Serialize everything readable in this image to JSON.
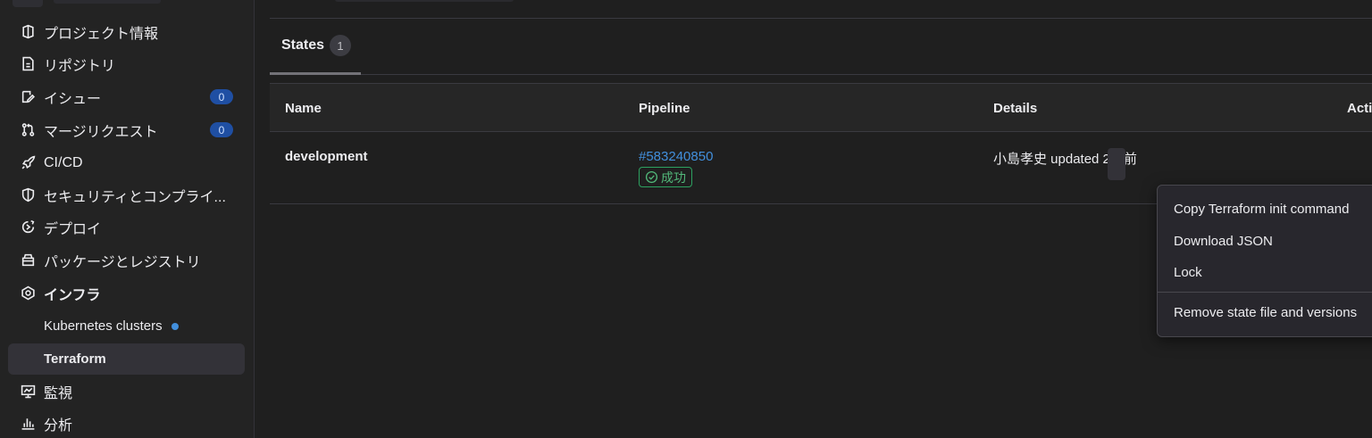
{
  "sidebar": {
    "items": [
      {
        "label": "プロジェクト情報",
        "icon": "project-icon"
      },
      {
        "label": "リポジトリ",
        "icon": "repository-icon"
      },
      {
        "label": "イシュー",
        "icon": "issues-icon",
        "badge": "0"
      },
      {
        "label": "マージリクエスト",
        "icon": "merge-request-icon",
        "badge": "0"
      },
      {
        "label": "CI/CD",
        "icon": "rocket-icon"
      },
      {
        "label": "セキュリティとコンプライ...",
        "icon": "shield-icon"
      },
      {
        "label": "デプロイ",
        "icon": "deployments-icon"
      },
      {
        "label": "パッケージとレジストリ",
        "icon": "package-icon"
      },
      {
        "label": "インフラ",
        "icon": "cloud-gear-icon"
      },
      {
        "label": "Kubernetes clusters"
      },
      {
        "label": "Terraform"
      },
      {
        "label": "監視",
        "icon": "monitor-icon"
      },
      {
        "label": "分析",
        "icon": "chart-icon"
      }
    ]
  },
  "tabs": [
    {
      "label": "States",
      "count": "1"
    }
  ],
  "table": {
    "headers": [
      "Name",
      "Pipeline",
      "Details",
      "Acti"
    ],
    "rows": [
      {
        "name": "development",
        "pipeline_id": "#583240850",
        "pipeline_status": "成功",
        "details": "小島孝史 updated 2日前"
      }
    ]
  },
  "dropdown": {
    "items": [
      "Copy Terraform init command",
      "Download JSON",
      "Lock",
      "Remove state file and versions"
    ]
  },
  "colors": {
    "background": "#1f1f1f",
    "sidebar": "#232323",
    "accent_link": "#428fdc",
    "success": "#52b87a",
    "badge": "#1f4fa3"
  }
}
